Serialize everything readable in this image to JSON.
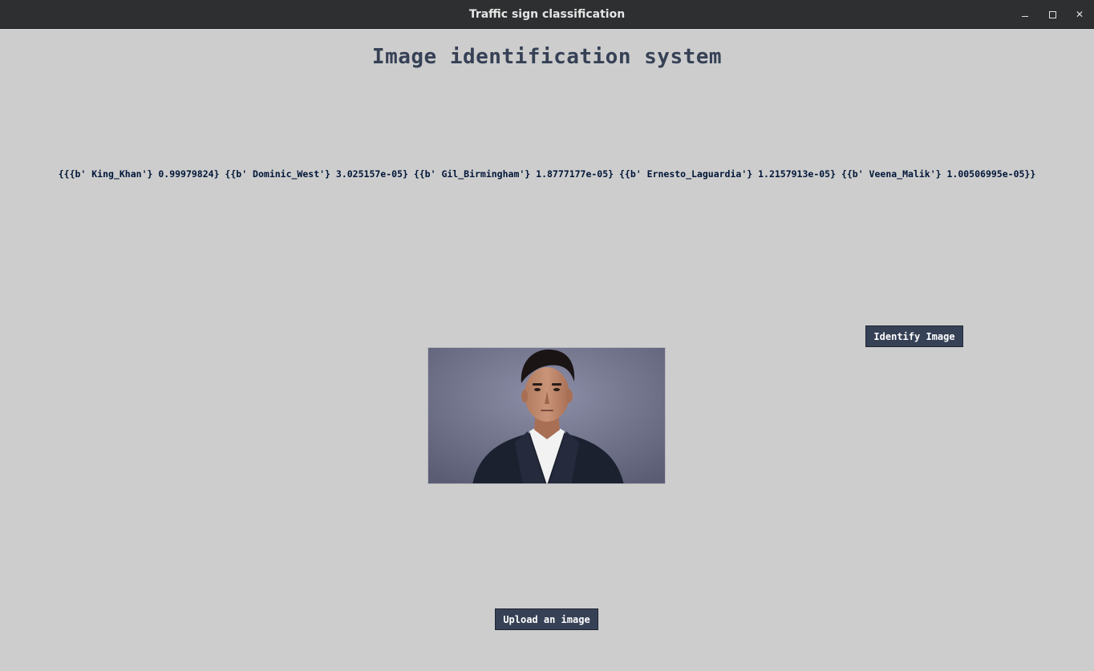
{
  "window": {
    "title": "Traffic sign classification",
    "controls": {
      "minimize": "minimize-icon",
      "maximize": "maximize-icon",
      "close": "close-icon"
    }
  },
  "main": {
    "heading": "Image identification system",
    "result_text": "{{{b' King_Khan'} 0.99979824} {{b' Dominic_West'} 3.025157e-05} {{b' Gil_Birmingham'} 1.8777177e-05} {{b' Ernesto_Laguardia'} 1.2157913e-05} {{b' Veena_Malik'} 1.00506995e-05}}",
    "identify_button_label": "Identify Image",
    "upload_button_label": "Upload an image"
  },
  "colors": {
    "background": "#cdcdcd",
    "titlebar": "#2d2f30",
    "heading": "#364156",
    "result_text": "#011638",
    "button_bg": "#364156",
    "button_text": "#ffffff"
  }
}
